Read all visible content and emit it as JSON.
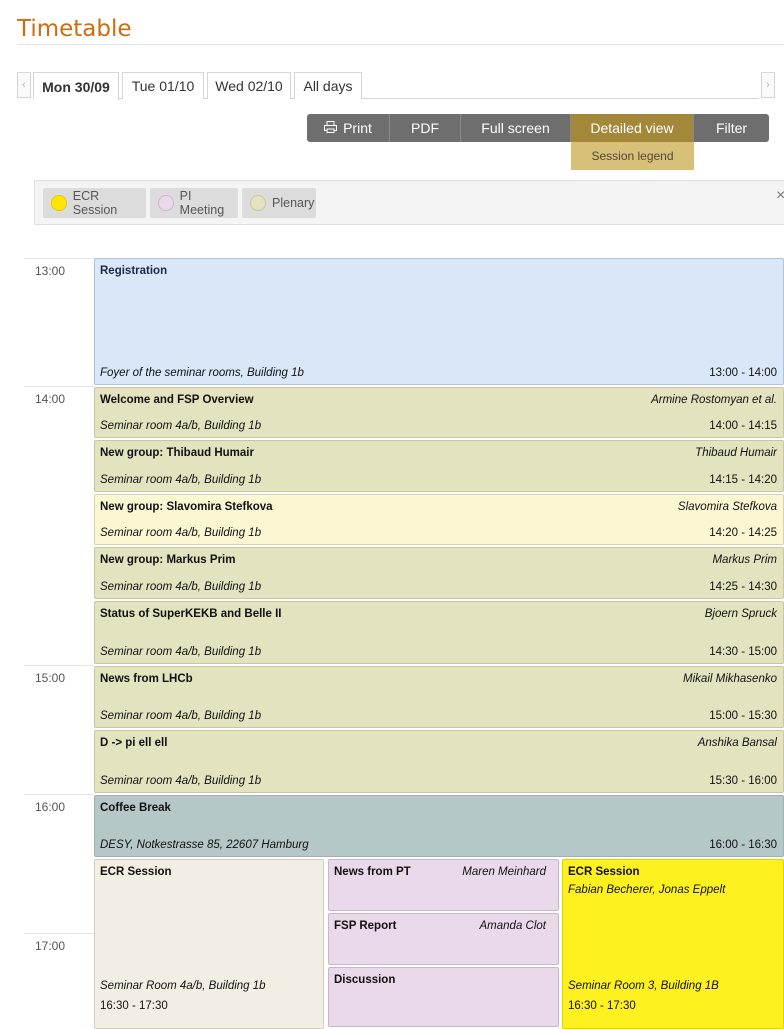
{
  "page": {
    "title": "Timetable"
  },
  "tabs": [
    {
      "label": "Mon 30/09",
      "active": true
    },
    {
      "label": "Tue 01/10"
    },
    {
      "label": "Wed 02/10"
    },
    {
      "label": "All days"
    }
  ],
  "toolbar": {
    "print": "Print",
    "print_icon": "printer-icon",
    "pdf": "PDF",
    "full_screen": "Full screen",
    "detailed_view": "Detailed view",
    "filter": "Filter",
    "session_legend": "Session legend",
    "active_color": "#a3883a"
  },
  "legend": {
    "items": [
      {
        "label": "ECR Session",
        "color": "#ffe600"
      },
      {
        "label": "PI Meeting",
        "color": "#ead9ea"
      },
      {
        "label": "Plenary",
        "color": "#e4e3bf"
      }
    ],
    "close": "×"
  },
  "hours": [
    "13:00",
    "14:00",
    "15:00",
    "16:00",
    "17:00"
  ],
  "entries": [
    {
      "title": "Registration",
      "speaker": "",
      "room": "Foyer of the seminar rooms, Building 1b",
      "time": "13:00 - 14:00"
    },
    {
      "title": "Welcome and FSP Overview",
      "speaker": "Armine Rostomyan et al.",
      "room": "Seminar room 4a/b, Building 1b",
      "time": "14:00 - 14:15"
    },
    {
      "title": "New group: Thibaud Humair",
      "speaker": "Thibaud Humair",
      "room": "Seminar room 4a/b, Building 1b",
      "time": "14:15 - 14:20"
    },
    {
      "title": "New group: Slavomira Stefkova",
      "speaker": "Slavomira Stefkova",
      "room": "Seminar room 4a/b, Building 1b",
      "time": "14:20 - 14:25"
    },
    {
      "title": "New group: Markus Prim",
      "speaker": "Markus Prim",
      "room": "Seminar room 4a/b, Building 1b",
      "time": "14:25 - 14:30"
    },
    {
      "title": "Status of SuperKEKB and Belle II",
      "speaker": "Bjoern Spruck",
      "room": "Seminar room 4a/b, Building 1b",
      "time": "14:30 - 15:00"
    },
    {
      "title": "News from LHCb",
      "speaker": "Mikail Mikhasenko",
      "room": "Seminar room 4a/b, Building 1b",
      "time": "15:00 - 15:30"
    },
    {
      "title": "D -> pi ell ell",
      "speaker": "Anshika Bansal",
      "room": "Seminar room 4a/b, Building 1b",
      "time": "15:30 - 16:00"
    },
    {
      "title": "Coffee Break",
      "speaker": "",
      "room": "DESY, Notkestrasse 85, 22607 Hamburg",
      "time": "16:00 - 16:30"
    }
  ],
  "parallel": {
    "ecr_left": {
      "title": "ECR Session",
      "room": "Seminar Room 4a/b, Building 1b",
      "time": "16:30 - 17:30"
    },
    "pi": [
      {
        "title": "News from PT",
        "speaker": "Maren Meinhard"
      },
      {
        "title": "FSP Report",
        "speaker": "Amanda Clot"
      },
      {
        "title": "Discussion",
        "speaker": ""
      }
    ],
    "ecr_right": {
      "title": "ECR Session",
      "speakers": "Fabian Becherer, Jonas Eppelt",
      "room": "Seminar Room 3, Building 1B",
      "time": "16:30 - 17:30"
    }
  }
}
